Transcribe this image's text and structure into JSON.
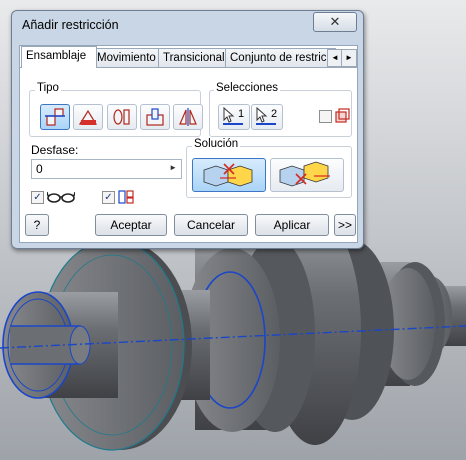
{
  "dialog": {
    "title": "Añadir restricción",
    "close_glyph": "✕",
    "tabs": [
      {
        "label": "Ensamblaje",
        "active": true
      },
      {
        "label": "Movimiento",
        "active": false
      },
      {
        "label": "Transicional",
        "active": false
      },
      {
        "label": "Conjunto de restricciones",
        "active": false
      }
    ],
    "tab_scroll": {
      "left": "◄",
      "right": "►"
    },
    "tipo": {
      "label": "Tipo",
      "buttons": [
        {
          "icon": "mate-icon",
          "selected": true
        },
        {
          "icon": "angle-icon",
          "selected": false
        },
        {
          "icon": "tangent-icon",
          "selected": false
        },
        {
          "icon": "insert-icon",
          "selected": false
        },
        {
          "icon": "symmetry-icon",
          "selected": false
        }
      ]
    },
    "selecciones": {
      "label": "Selecciones",
      "sel1": "1",
      "sel2": "2",
      "first_selection_checked": false
    },
    "desfase": {
      "label": "Desfase:",
      "value": "0"
    },
    "solucion": {
      "label": "Solución",
      "options": [
        "mate",
        "flush"
      ],
      "selected": 0
    },
    "options": {
      "show_preview_checked": true,
      "predict_offset_checked": true
    },
    "buttons": {
      "help": "?",
      "ok": "Aceptar",
      "cancel": "Cancelar",
      "apply": "Aplicar",
      "more": ">>"
    }
  },
  "colors": {
    "accent": "#2f6fd0",
    "highlight_blue": "#1a46c9",
    "selected_button": "#b5dbf9",
    "model_gray": "#5e6166",
    "viewport_bg": "#b3b7bc"
  }
}
